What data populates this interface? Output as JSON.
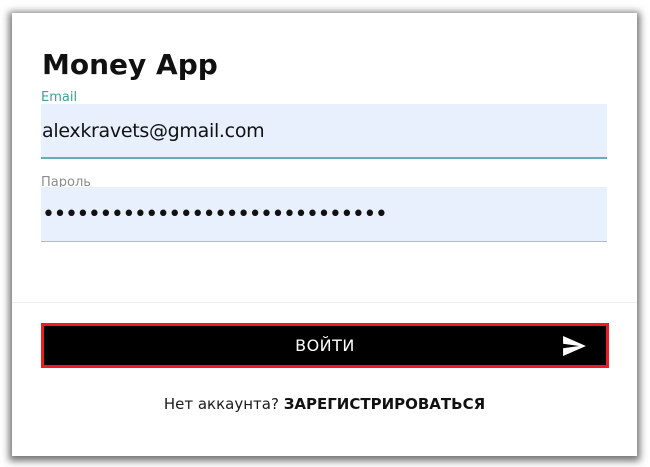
{
  "app": {
    "title": "Money App"
  },
  "form": {
    "email": {
      "label": "Email",
      "value": "alexkravets@gmail.com"
    },
    "password": {
      "label": "Пароль",
      "value": "••••••••••••••••••••••••••••••"
    }
  },
  "login_button": {
    "label": "ВОЙТИ",
    "icon": "send-icon"
  },
  "signup": {
    "prompt": "Нет аккаунта?",
    "link": "ЗАРЕГИСТРИРОВАТЬСЯ"
  },
  "colors": {
    "card_background": "#ffffff",
    "input_background": "#e8f0fe",
    "email_label": "#3c9f9a",
    "email_underline": "#5fb2b6",
    "password_label": "#8d8d8d",
    "button_background": "#000000",
    "button_border": "#ee1c1c",
    "button_text": "#ffffff"
  }
}
